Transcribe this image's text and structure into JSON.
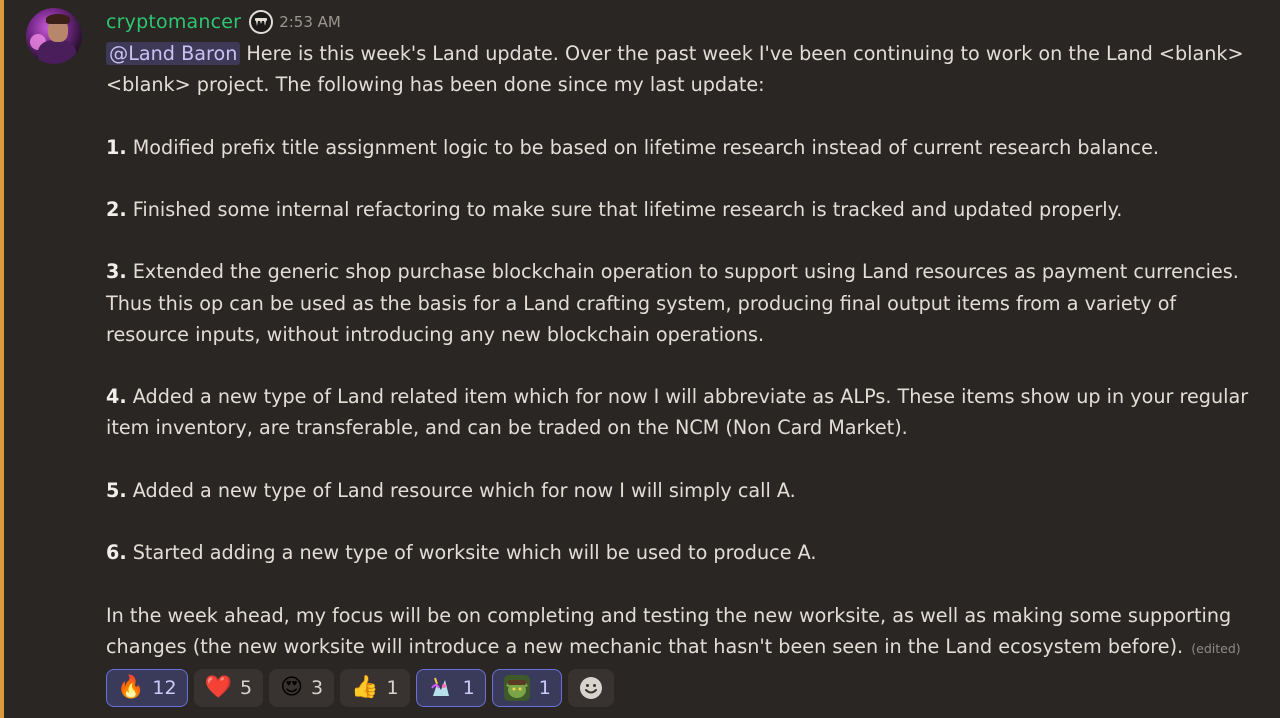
{
  "author": {
    "name": "cryptomancer",
    "timestamp": "2:53 AM"
  },
  "message": {
    "mention": "@Land Baron",
    "intro": "Here is this week's Land update. Over the past week I've been continuing to work on the Land <blank> <blank> project. The following has been done since my last update:",
    "items": [
      {
        "num": "1.",
        "text": "Modified prefix title assignment logic to be based on lifetime research instead of current research balance."
      },
      {
        "num": "2.",
        "text": "Finished some internal refactoring to make sure that lifetime research is tracked and updated properly."
      },
      {
        "num": "3.",
        "text": "Extended the generic shop purchase blockchain operation to support using Land resources as payment currencies. Thus this op can be used as the basis for a Land crafting system, producing final output items from a variety of resource inputs, without introducing any new blockchain operations."
      },
      {
        "num": "4.",
        "text": "Added a new type of Land related item which for now I will abbreviate as ALPs. These items show up in your regular item inventory, are transferable, and can be traded on the NCM (Non Card Market)."
      },
      {
        "num": "5.",
        "text": "Added a new type of Land resource which for now I will simply call A."
      },
      {
        "num": "6.",
        "text": "Started adding a new type of worksite which will be used to produce A."
      }
    ],
    "outro": "In the week ahead, my focus will be on completing and testing the new worksite, as well as making some supporting changes (the new worksite will introduce a new mechanic that hasn't been seen in the Land ecosystem before).",
    "edited": "(edited)"
  },
  "reactions": [
    {
      "emoji": "🔥",
      "count": "12",
      "active": true
    },
    {
      "emoji": "❤️",
      "count": "5",
      "active": false
    },
    {
      "emoji": "😍",
      "count": "3",
      "active": false
    },
    {
      "emoji": "👍",
      "count": "1",
      "active": false
    },
    {
      "emoji": "custom-unicorn",
      "count": "1",
      "active": true
    },
    {
      "emoji": "custom-goblin",
      "count": "1",
      "active": true
    }
  ],
  "colors": {
    "username": "#2dc770",
    "mention_bg": "#3e3956",
    "highlight_bar": "#d89a3c",
    "background": "#2a2624"
  }
}
